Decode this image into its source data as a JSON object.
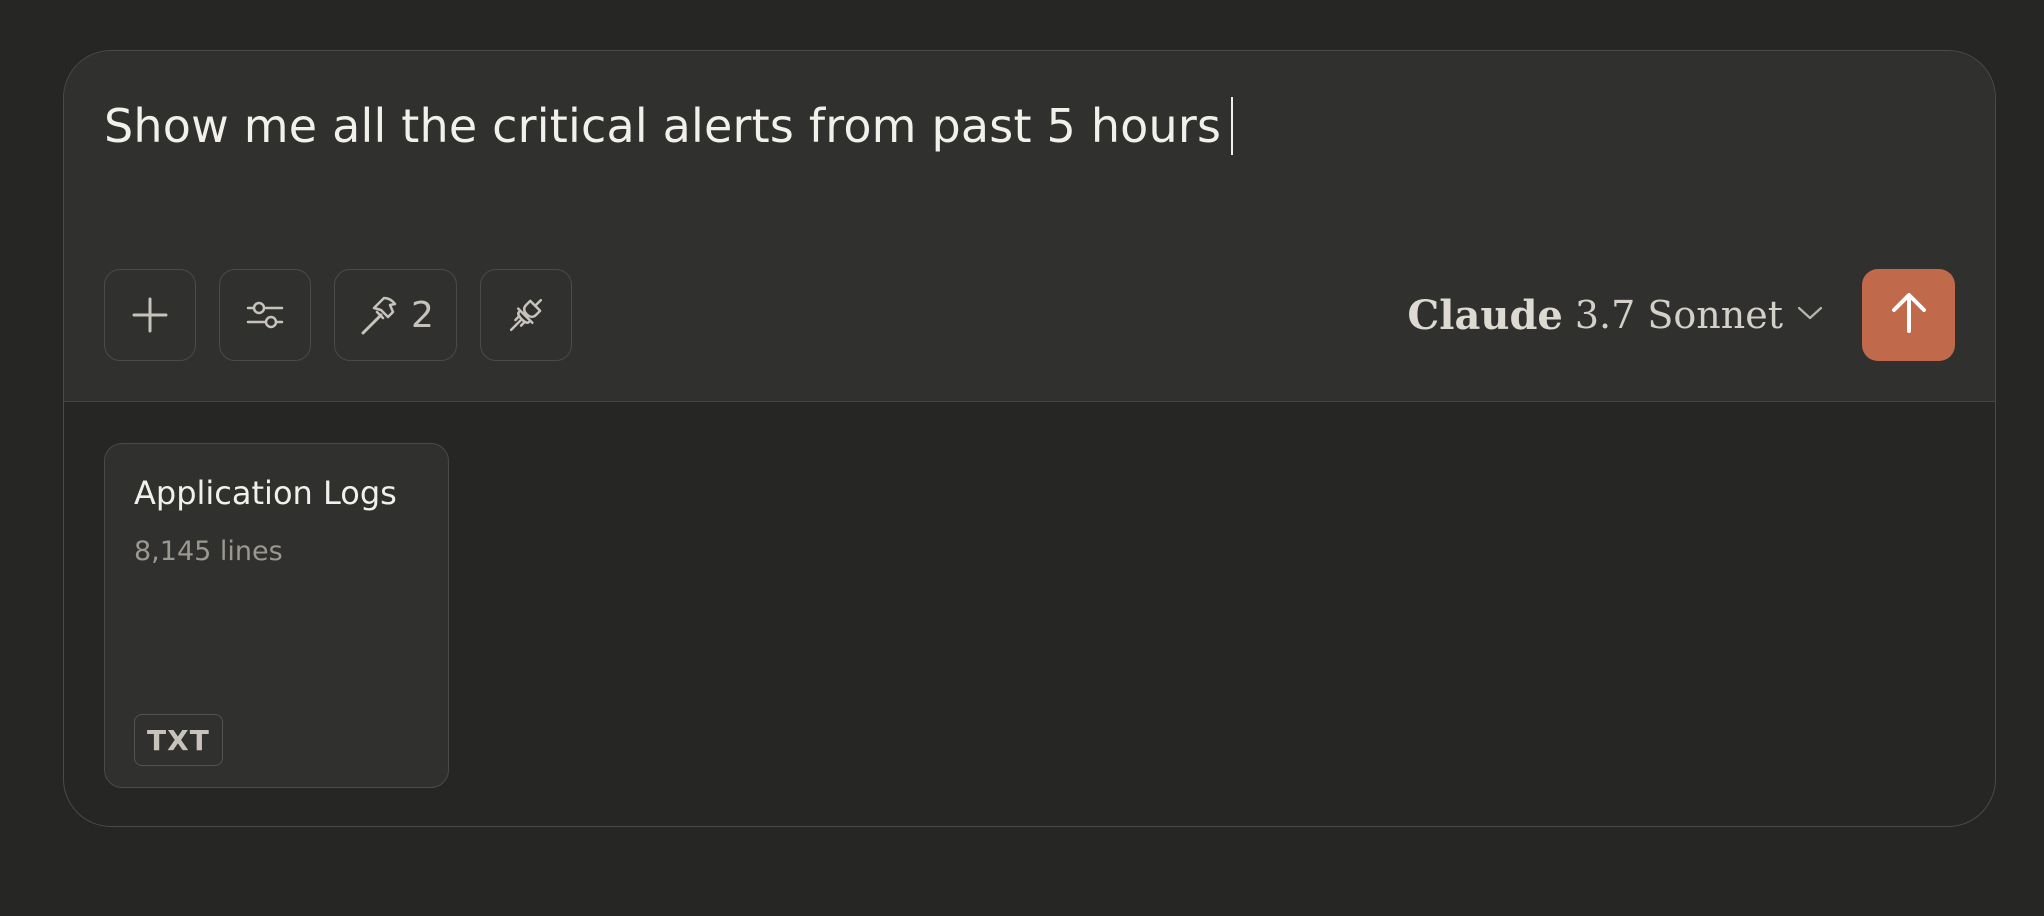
{
  "composer": {
    "prompt_text": "Show me all the critical alerts from past 5 hours",
    "toolbar": {
      "add_icon": "plus-icon",
      "settings_icon": "sliders-icon",
      "tools_icon": "hammer-icon",
      "tools_count": "2",
      "integrations_icon": "plug-icon"
    },
    "model_picker": {
      "name": "Claude",
      "version": "3.7 Sonnet",
      "icon": "chevron-down-icon"
    },
    "send_button": {
      "icon": "arrow-up-icon",
      "color": "#c1694b"
    }
  },
  "attachment": {
    "title": "Application Logs",
    "subtitle": "8,145 lines",
    "badge": "TXT"
  },
  "colors": {
    "background": "#262624",
    "input_background": "#30302e",
    "accent": "#c1694b"
  }
}
